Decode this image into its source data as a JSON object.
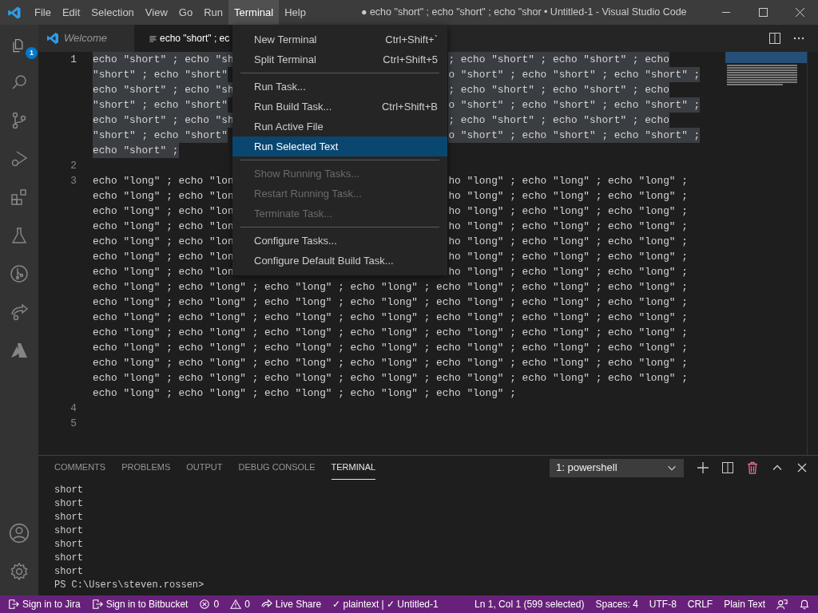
{
  "title_bar": {
    "menu": [
      {
        "label": "File",
        "selected": false
      },
      {
        "label": "Edit",
        "selected": false
      },
      {
        "label": "Selection",
        "selected": false
      },
      {
        "label": "View",
        "selected": false
      },
      {
        "label": "Go",
        "selected": false
      },
      {
        "label": "Run",
        "selected": false
      },
      {
        "label": "Terminal",
        "selected": true
      },
      {
        "label": "Help",
        "selected": false
      }
    ],
    "title": "● echo \"short\" ; echo \"short\" ; echo \"shor • Untitled-1 - Visual Studio Code"
  },
  "activity_bar": {
    "explorer_badge": "1"
  },
  "tabs": [
    {
      "label": "Welcome",
      "kind": "welcome",
      "selected": false
    },
    {
      "label": "echo \"short\" ; ec",
      "kind": "file",
      "selected": true
    }
  ],
  "editor": {
    "lines": [
      {
        "number": "1",
        "selected": true,
        "rows": [
          {
            "left": "echo \"short\" ; echo \"sh",
            "right": "; echo \"short\" ; echo \"short\" ; echo"
          },
          {
            "left": "\"short\" ; echo \"short\"",
            "right": "o \"short\" ; echo \"short\" ; echo \"short\" ;"
          },
          {
            "left": "echo \"short\" ; echo \"sh",
            "right": "; echo \"short\" ; echo \"short\" ; echo"
          },
          {
            "left": "\"short\" ; echo \"short\"",
            "right": "o \"short\" ; echo \"short\" ; echo \"short\" ;"
          },
          {
            "left": "echo \"short\" ; echo \"sh",
            "right": "; echo \"short\" ; echo \"short\" ; echo"
          },
          {
            "left": "\"short\" ; echo \"short\"",
            "right": "o \"short\" ; echo \"short\" ; echo \"short\" ;"
          },
          {
            "text": "echo \"short\" ;"
          }
        ]
      },
      {
        "number": "2",
        "selected": false,
        "rows": [
          {
            "text": ""
          }
        ]
      },
      {
        "number": "3",
        "selected": false,
        "rows": [
          {
            "left": "echo \"long\" ; echo \"lon",
            "right": "ho \"long\" ; echo \"long\" ; echo \"long\" ;"
          },
          {
            "left": "echo \"long\" ; echo \"lon",
            "right": "ho \"long\" ; echo \"long\" ; echo \"long\" ;"
          },
          {
            "left": "echo \"long\" ; echo \"lon",
            "right": "ho \"long\" ; echo \"long\" ; echo \"long\" ;"
          },
          {
            "left": "echo \"long\" ; echo \"lon",
            "right": "ho \"long\" ; echo \"long\" ; echo \"long\" ;"
          },
          {
            "left": "echo \"long\" ; echo \"lon",
            "right": "ho \"long\" ; echo \"long\" ; echo \"long\" ;"
          },
          {
            "left": "echo \"long\" ; echo \"lon",
            "right": "ho \"long\" ; echo \"long\" ; echo \"long\" ;"
          },
          {
            "left": "echo \"long\" ; echo \"lon",
            "right": "ho \"long\" ; echo \"long\" ; echo \"long\" ;"
          },
          {
            "text": "echo \"long\" ; echo \"long\" ; echo \"long\" ; echo \"long\" ; echo \"long\" ; echo \"long\" ; echo \"long\" ;"
          },
          {
            "text": "echo \"long\" ; echo \"long\" ; echo \"long\" ; echo \"long\" ; echo \"long\" ; echo \"long\" ; echo \"long\" ;"
          },
          {
            "text": "echo \"long\" ; echo \"long\" ; echo \"long\" ; echo \"long\" ; echo \"long\" ; echo \"long\" ; echo \"long\" ;"
          },
          {
            "text": "echo \"long\" ; echo \"long\" ; echo \"long\" ; echo \"long\" ; echo \"long\" ; echo \"long\" ; echo \"long\" ;"
          },
          {
            "text": "echo \"long\" ; echo \"long\" ; echo \"long\" ; echo \"long\" ; echo \"long\" ; echo \"long\" ; echo \"long\" ;"
          },
          {
            "text": "echo \"long\" ; echo \"long\" ; echo \"long\" ; echo \"long\" ; echo \"long\" ; echo \"long\" ; echo \"long\" ;"
          },
          {
            "text": "echo \"long\" ; echo \"long\" ; echo \"long\" ; echo \"long\" ; echo \"long\" ; echo \"long\" ; echo \"long\" ;"
          },
          {
            "text": "echo \"long\" ; echo \"long\" ; echo \"long\" ; echo \"long\" ; echo \"long\" ;"
          }
        ]
      },
      {
        "number": "4",
        "selected": false,
        "rows": [
          {
            "text": ""
          }
        ]
      },
      {
        "number": "5",
        "selected": false,
        "rows": [
          {
            "text": ""
          }
        ]
      }
    ]
  },
  "terminal_menu": [
    {
      "kind": "item",
      "label": "New Terminal",
      "shortcut": "Ctrl+Shift+`",
      "disabled": false,
      "selected": false
    },
    {
      "kind": "item",
      "label": "Split Terminal",
      "shortcut": "Ctrl+Shift+5",
      "disabled": false,
      "selected": false
    },
    {
      "kind": "separator"
    },
    {
      "kind": "item",
      "label": "Run Task...",
      "disabled": false,
      "selected": false
    },
    {
      "kind": "item",
      "label": "Run Build Task...",
      "shortcut": "Ctrl+Shift+B",
      "disabled": false,
      "selected": false
    },
    {
      "kind": "item",
      "label": "Run Active File",
      "disabled": false,
      "selected": false
    },
    {
      "kind": "item",
      "label": "Run Selected Text",
      "disabled": false,
      "selected": true
    },
    {
      "kind": "separator"
    },
    {
      "kind": "item",
      "label": "Show Running Tasks...",
      "disabled": true,
      "selected": false
    },
    {
      "kind": "item",
      "label": "Restart Running Task...",
      "disabled": true,
      "selected": false
    },
    {
      "kind": "item",
      "label": "Terminate Task...",
      "disabled": true,
      "selected": false
    },
    {
      "kind": "separator"
    },
    {
      "kind": "item",
      "label": "Configure Tasks...",
      "disabled": false,
      "selected": false
    },
    {
      "kind": "item",
      "label": "Configure Default Build Task...",
      "disabled": false,
      "selected": false
    }
  ],
  "panel": {
    "tabs": [
      {
        "label": "COMMENTS",
        "selected": false
      },
      {
        "label": "PROBLEMS",
        "selected": false
      },
      {
        "label": "OUTPUT",
        "selected": false
      },
      {
        "label": "DEBUG CONSOLE",
        "selected": false
      },
      {
        "label": "TERMINAL",
        "selected": true
      }
    ],
    "terminal_select": "1: powershell",
    "terminal_lines": [
      "short",
      "short",
      "short",
      "short",
      "short",
      "short",
      "short",
      "PS C:\\Users\\steven.rossen>"
    ]
  },
  "status_bar": {
    "left": [
      {
        "kind": "jira",
        "text": "Sign in to Jira"
      },
      {
        "kind": "bitbucket",
        "text": "Sign in to Bitbucket"
      },
      {
        "kind": "errors",
        "text": "0"
      },
      {
        "kind": "warnings",
        "text": "0"
      },
      {
        "kind": "liveshare",
        "text": "Live Share"
      },
      {
        "kind": "plain",
        "text": "✓ plaintext | ✓ Untitled-1"
      }
    ],
    "right": [
      {
        "kind": "plain",
        "text": "Ln 1, Col 1 (599 selected)"
      },
      {
        "kind": "plain",
        "text": "Spaces: 4"
      },
      {
        "kind": "plain",
        "text": "UTF-8"
      },
      {
        "kind": "plain",
        "text": "CRLF"
      },
      {
        "kind": "plain",
        "text": "Plain Text"
      },
      {
        "kind": "feedback"
      },
      {
        "kind": "bell"
      }
    ]
  }
}
